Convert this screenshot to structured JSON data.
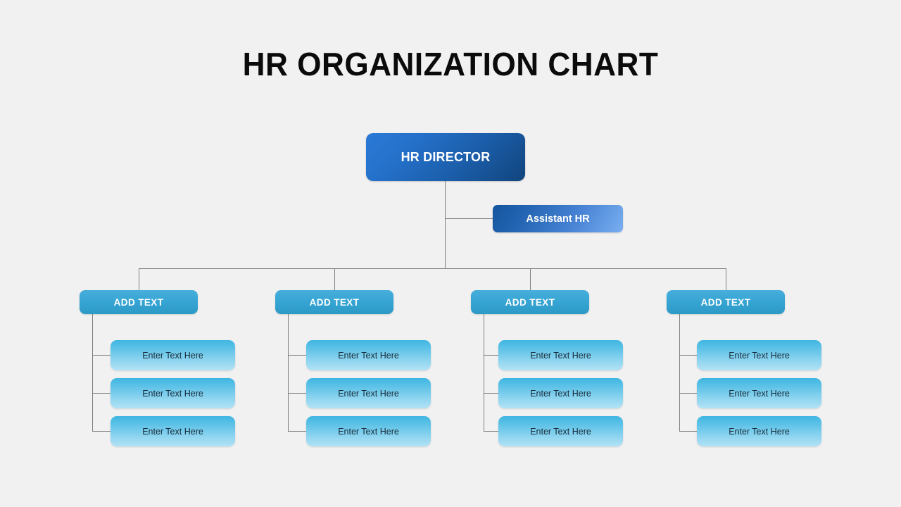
{
  "page": {
    "title": "HR ORGANIZATION CHART",
    "background_color": "#f1f1f1",
    "connector_color": "#808080"
  },
  "chart_data": {
    "type": "diagram",
    "diagram_type": "organization-chart",
    "title": "HR ORGANIZATION CHART",
    "orientation": "top-down",
    "levels": 4,
    "root": {
      "label": "HR DIRECTOR",
      "level": 1,
      "color_start": "#2a7ad6",
      "color_end": "#11457d",
      "text_color": "#ffffff"
    },
    "assistant": {
      "label": "Assistant HR",
      "level": 2,
      "attached_to": "HR DIRECTOR",
      "color_start": "#16559f",
      "color_end": "#79aff0",
      "text_color": "#ffffff"
    },
    "departments": [
      {
        "label": "ADD TEXT",
        "level": 3,
        "children": [
          {
            "label": "Enter Text Here"
          },
          {
            "label": "Enter Text Here"
          },
          {
            "label": "Enter Text Here"
          }
        ]
      },
      {
        "label": "ADD TEXT",
        "level": 3,
        "children": [
          {
            "label": "Enter Text Here"
          },
          {
            "label": "Enter Text Here"
          },
          {
            "label": "Enter Text Here"
          }
        ]
      },
      {
        "label": "ADD TEXT",
        "level": 3,
        "children": [
          {
            "label": "Enter Text Here"
          },
          {
            "label": "Enter Text Here"
          },
          {
            "label": "Enter Text Here"
          }
        ]
      },
      {
        "label": "ADD TEXT",
        "level": 3,
        "children": [
          {
            "label": "Enter Text Here"
          },
          {
            "label": "Enter Text Here"
          },
          {
            "label": "Enter Text Here"
          }
        ]
      }
    ],
    "department_color_start": "#46aedb",
    "department_color_end": "#2c99c6",
    "department_text_color": "#ffffff",
    "leaf_color_start": "#3fb6e2",
    "leaf_color_end": "#b2e2f6",
    "leaf_text_color": "#182b3a"
  }
}
